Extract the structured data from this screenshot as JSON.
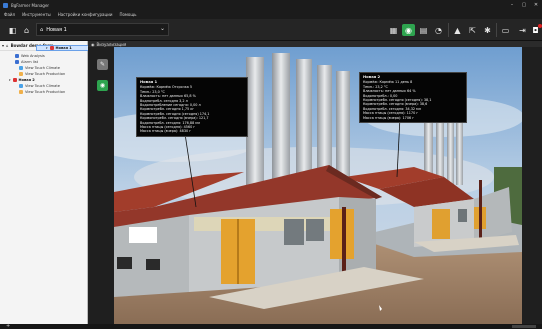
{
  "window": {
    "title": "BgFarmer Manager",
    "min": "–",
    "max": "▢",
    "close": "✕"
  },
  "menu": [
    "Файл",
    "Инструменты",
    "Настройки конфигурации",
    "Помощь"
  ],
  "toolbar": {
    "selector_value": "Новая 1"
  },
  "tree": {
    "root_label": "Bowdar demo farm",
    "items": [
      {
        "label": "Web Analysis",
        "color": "#3b6fd1"
      },
      {
        "label": "Alarm list",
        "color": "#3b6fd1"
      },
      {
        "label": "Новая 1",
        "color": "#d33",
        "bold": true,
        "selected": true
      },
      {
        "label": "View Touch Climate",
        "color": "#4aa2e8"
      },
      {
        "label": "View Touch Production",
        "color": "#f0b04a"
      },
      {
        "label": "Новая 2",
        "color": "#d33",
        "bold": true
      },
      {
        "label": "View Touch Climate",
        "color": "#4aa2e8"
      },
      {
        "label": "View Touch Production",
        "color": "#f0b04a"
      }
    ]
  },
  "tab": {
    "label": "Визуализация"
  },
  "house1": {
    "title": "Новая 1",
    "lines": [
      "Кормёж: Кормёж Отсрочка 5",
      "Темп.: 23,0 °C",
      "Влажность: нет данных 65,8 %",
      "Водпотребл. сегодня 3,2 л",
      "Водопотребление сегодня: 0,00 л",
      "Кормпотребл. сегодня 1,75 кг",
      "Кормпотребл. сегодня (сегодня) 174,1",
      "Кормопотребл. сегодня (вчера): 121,7",
      "Водопотребл. сегодня: 176,88 мл",
      "Масса птицы (сегодня): 4560 г",
      "Масса птицы (вчера): 4830 г"
    ]
  },
  "house2": {
    "title": "Новая 2",
    "lines": [
      "Кормёж: Кормёж 11 день 8",
      "Темп.: 23,2 °C",
      "Влажность: нет данных 64 %",
      "Водопотребл.: 0,00",
      "Кормпотребл. сегодня (сегодня): 38,1",
      "Кормпотребл. сегодня (вчера): 38,6",
      "Водопотребл. сегодня: 34,32 мл",
      "Масса птицы (сегодня): 1170 г",
      "Масса птицы (вчера): 1706 г"
    ]
  }
}
